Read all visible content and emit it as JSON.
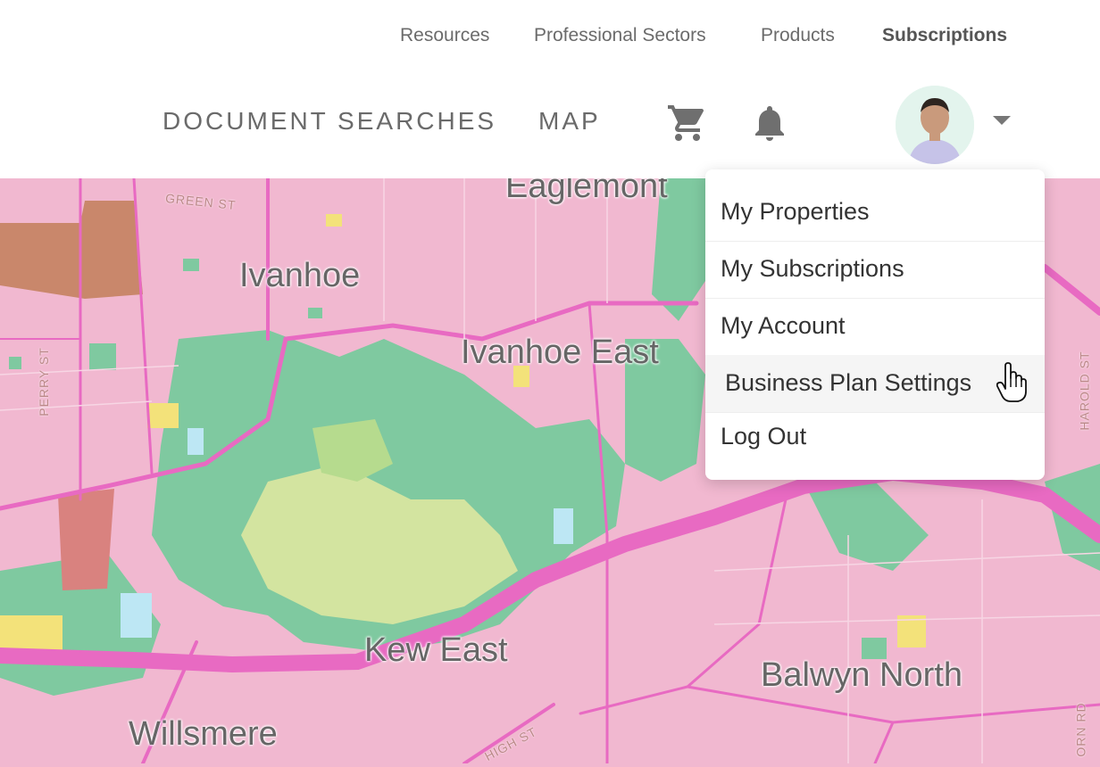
{
  "top_nav": {
    "resources": "Resources",
    "professional_sectors": "Professional Sectors",
    "products": "Products",
    "subscriptions": "Subscriptions"
  },
  "main_nav": {
    "document_searches": "DOCUMENT SEARCHES",
    "map": "MAP"
  },
  "icons": {
    "cart": "cart-icon",
    "notifications": "bell-icon",
    "menu_caret": "chevron-down-icon"
  },
  "user_menu": {
    "items": [
      {
        "label": "My Properties"
      },
      {
        "label": "My Subscriptions"
      },
      {
        "label": "My Account"
      },
      {
        "label": "Business Plan Settings"
      },
      {
        "label": "Log Out"
      }
    ]
  },
  "map": {
    "places": [
      "Eaglemont",
      "Ivanhoe",
      "Ivanhoe East",
      "Kew East",
      "Balwyn North",
      "Willsmere"
    ],
    "streets": [
      "GREEN ST",
      "PERRY ST",
      "HAROLD ST",
      "HIGH ST",
      "ORN RD"
    ],
    "colors": {
      "residential": "#f1b8d0",
      "parkland": "#7fc9a0",
      "golf": "#d3e4a0",
      "commercial": "#c9876b",
      "water": "#bde7f4",
      "road": "#e86ac2"
    }
  }
}
